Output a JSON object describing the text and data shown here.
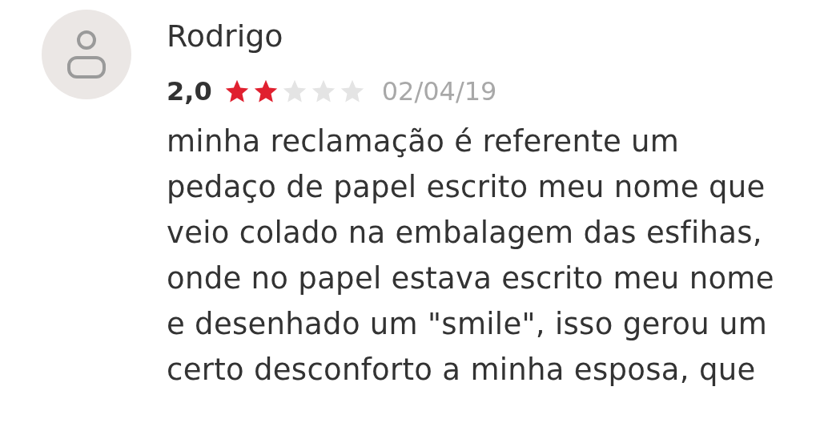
{
  "review": {
    "author": "Rodrigo",
    "score": "2,0",
    "stars": 2,
    "date": "02/04/19",
    "text": "minha reclamação é referente um pedaço de papel escrito meu nome que veio colado na embalagem das esfihas, onde no papel estava escrito meu nome e desenhado um \"smile\", isso gerou um certo desconforto a minha esposa, que"
  }
}
